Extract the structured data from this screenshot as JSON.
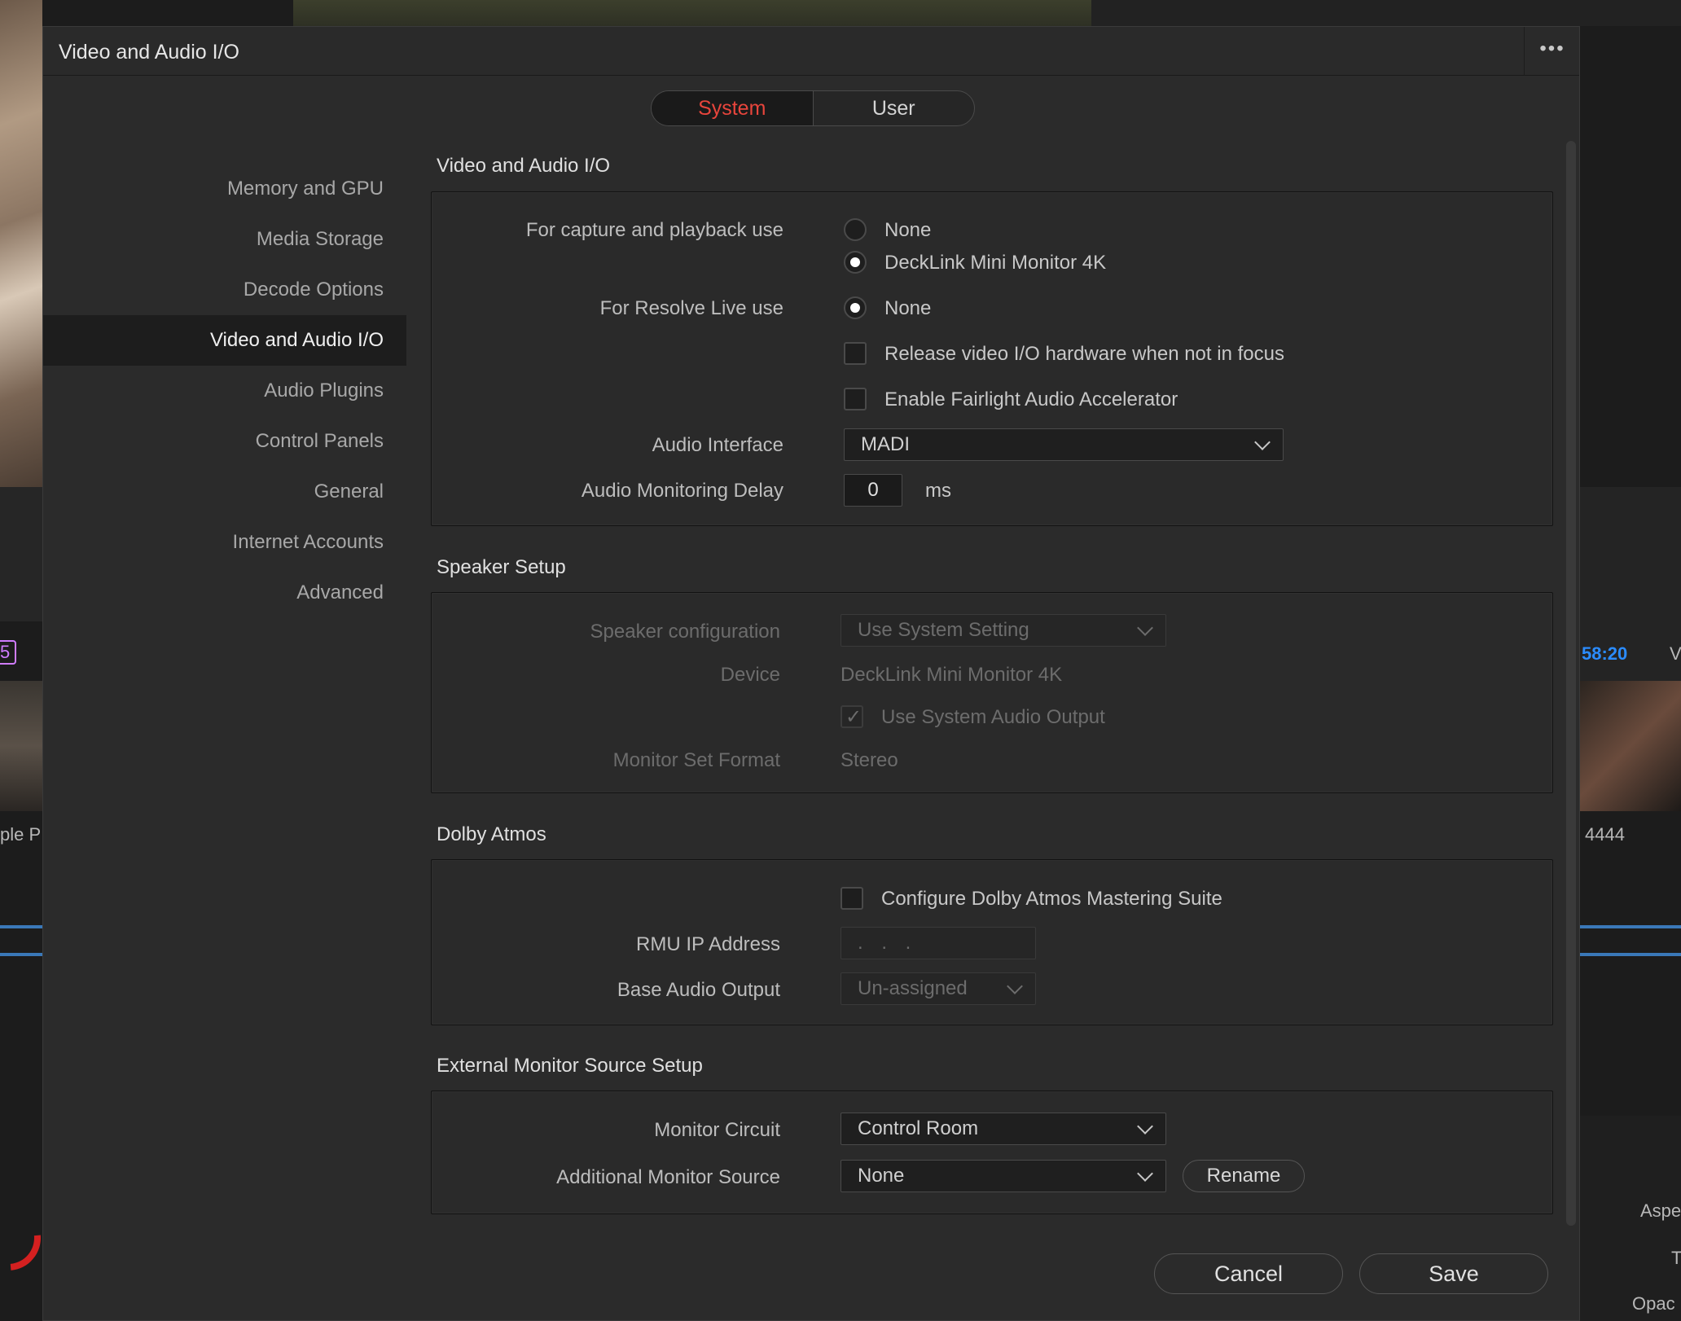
{
  "background": {
    "timecode": "58:20",
    "right_letter": "V",
    "left_badge": "5",
    "left_clip_label": "ple P",
    "right_clip_label": "4444",
    "aspect_label": "Aspe",
    "t_label": "T",
    "opacity_label": "Opac"
  },
  "dialog": {
    "title": "Video and Audio I/O",
    "more_icon": "•••",
    "tabs": [
      {
        "label": "System",
        "active": true
      },
      {
        "label": "User",
        "active": false
      }
    ],
    "accent_color": "#e8453c"
  },
  "sidebar": {
    "items": [
      {
        "label": "Memory and GPU"
      },
      {
        "label": "Media Storage"
      },
      {
        "label": "Decode Options"
      },
      {
        "label": "Video and Audio I/O",
        "selected": true
      },
      {
        "label": "Audio Plugins"
      },
      {
        "label": "Control Panels"
      },
      {
        "label": "General"
      },
      {
        "label": "Internet Accounts"
      },
      {
        "label": "Advanced"
      }
    ]
  },
  "video_audio_io": {
    "title": "Video and Audio I/O",
    "capture_label": "For capture and playback use",
    "capture_options": [
      "None",
      "DeckLink Mini Monitor 4K"
    ],
    "capture_selected": "DeckLink Mini Monitor 4K",
    "resolve_live_label": "For Resolve Live use",
    "resolve_live_option": "None",
    "release_hw_label": "Release video I/O hardware when not in focus",
    "release_hw_checked": false,
    "fairlight_label": "Enable Fairlight Audio Accelerator",
    "fairlight_checked": false,
    "audio_interface_label": "Audio Interface",
    "audio_interface_value": "MADI",
    "monitoring_delay_label": "Audio Monitoring Delay",
    "monitoring_delay_value": "0",
    "monitoring_delay_unit": "ms"
  },
  "speaker_setup": {
    "title": "Speaker Setup",
    "config_label": "Speaker configuration",
    "config_value": "Use System Setting",
    "device_label": "Device",
    "device_value": "DeckLink Mini Monitor 4K",
    "system_output_label": "Use System Audio Output",
    "system_output_checked": true,
    "monitor_set_label": "Monitor Set Format",
    "monitor_set_value": "Stereo"
  },
  "dolby_atmos": {
    "title": "Dolby Atmos",
    "configure_label": "Configure Dolby Atmos Mastering Suite",
    "configure_checked": false,
    "rmu_label": "RMU IP Address",
    "rmu_value": " . . .",
    "base_output_label": "Base Audio Output",
    "base_output_value": "Un-assigned"
  },
  "external_monitor": {
    "title": "External Monitor Source Setup",
    "circuit_label": "Monitor Circuit",
    "circuit_value": "Control Room",
    "additional_label": "Additional Monitor Source",
    "additional_value": "None",
    "rename_label": "Rename"
  },
  "footer": {
    "cancel_label": "Cancel",
    "save_label": "Save"
  }
}
